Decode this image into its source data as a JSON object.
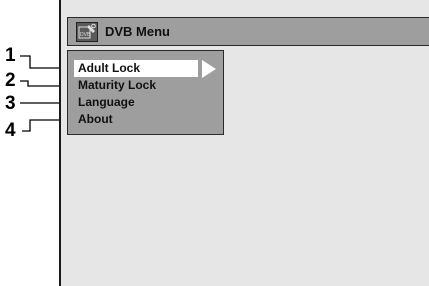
{
  "window": {
    "title": "DVB Menu",
    "icon": "dvb-icon"
  },
  "menu": {
    "items": [
      {
        "label": "Adult Lock",
        "selected": true
      },
      {
        "label": "Maturity Lock",
        "selected": false
      },
      {
        "label": "Language",
        "selected": false
      },
      {
        "label": "About",
        "selected": false
      }
    ],
    "selection_arrow_icon": "right-arrow-icon"
  },
  "callouts": [
    "1",
    "2",
    "3",
    "4"
  ]
}
